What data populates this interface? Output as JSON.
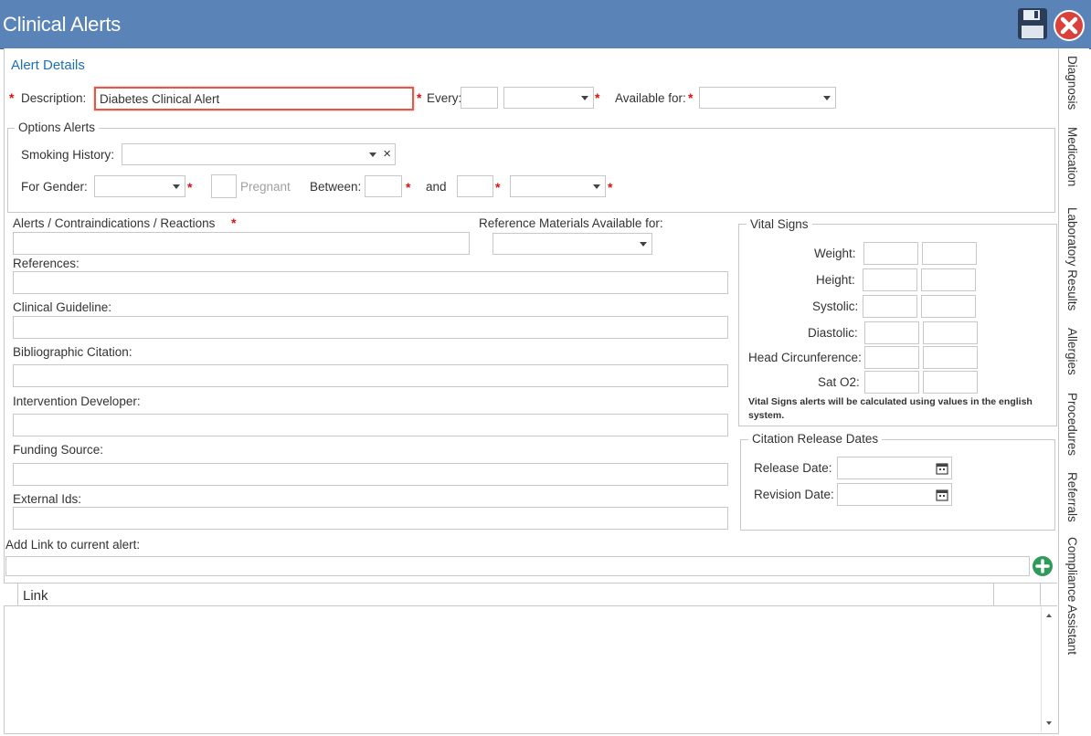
{
  "window": {
    "title": "Clinical Alerts"
  },
  "toolbar": {
    "save_icon": "floppy-disk-icon",
    "close_icon": "close-x-icon"
  },
  "section": {
    "title": "Alert Details"
  },
  "description": {
    "label": "Description:",
    "value": "Diabetes Clinical Alert"
  },
  "every": {
    "label": "Every:",
    "value": "",
    "unit": ""
  },
  "available_for": {
    "label": "Available for:",
    "value": ""
  },
  "options": {
    "legend": "Options Alerts",
    "smoking_label": "Smoking History:",
    "smoking_value": "",
    "clear_glyph": "×",
    "gender_label": "For Gender:",
    "gender_value": "",
    "pregnant_label": "Pregnant",
    "between_label": "Between:",
    "between_value": "",
    "and_label": "and",
    "and_value": "",
    "age_unit": ""
  },
  "fields": {
    "alerts_label": "Alerts / Contraindications / Reactions",
    "alerts_value": "",
    "ref_materials_label": "Reference Materials Available for:",
    "ref_materials_value": "",
    "references_label": "References:",
    "clinical_guideline_label": "Clinical Guideline:",
    "bibliographic_label": "Bibliographic Citation:",
    "intervention_label": "Intervention Developer:",
    "funding_label": "Funding Source:",
    "external_ids_label": "External Ids:",
    "add_link_label": "Add Link to current alert:",
    "add_link_value": ""
  },
  "vital_signs": {
    "legend": "Vital Signs",
    "rows": [
      {
        "label": "Weight:"
      },
      {
        "label": "Height:"
      },
      {
        "label": "Systolic:"
      },
      {
        "label": "Diastolic:"
      },
      {
        "label": "Head Circunference:"
      },
      {
        "label": "Sat O2:"
      }
    ],
    "note": "Vital Signs alerts will be calculated using values in the english system."
  },
  "citation": {
    "legend": "Citation Release Dates",
    "release_label": "Release Date:",
    "revision_label": "Revision Date:",
    "release_value": "",
    "revision_value": ""
  },
  "grid": {
    "column_link": "Link"
  },
  "side_tabs": [
    "Diagnosis",
    "Medication",
    "Laboratory Results",
    "Allergies",
    "Procedures",
    "Referrals",
    "Compliance Assistant"
  ],
  "colors": {
    "title_bar": "#5a84b8",
    "section_title": "#1f6fb8",
    "required": "#dd1111",
    "highlight_border": "#e05a4a",
    "add_button": "#2f9a5a",
    "close_button": "#d9413a"
  }
}
